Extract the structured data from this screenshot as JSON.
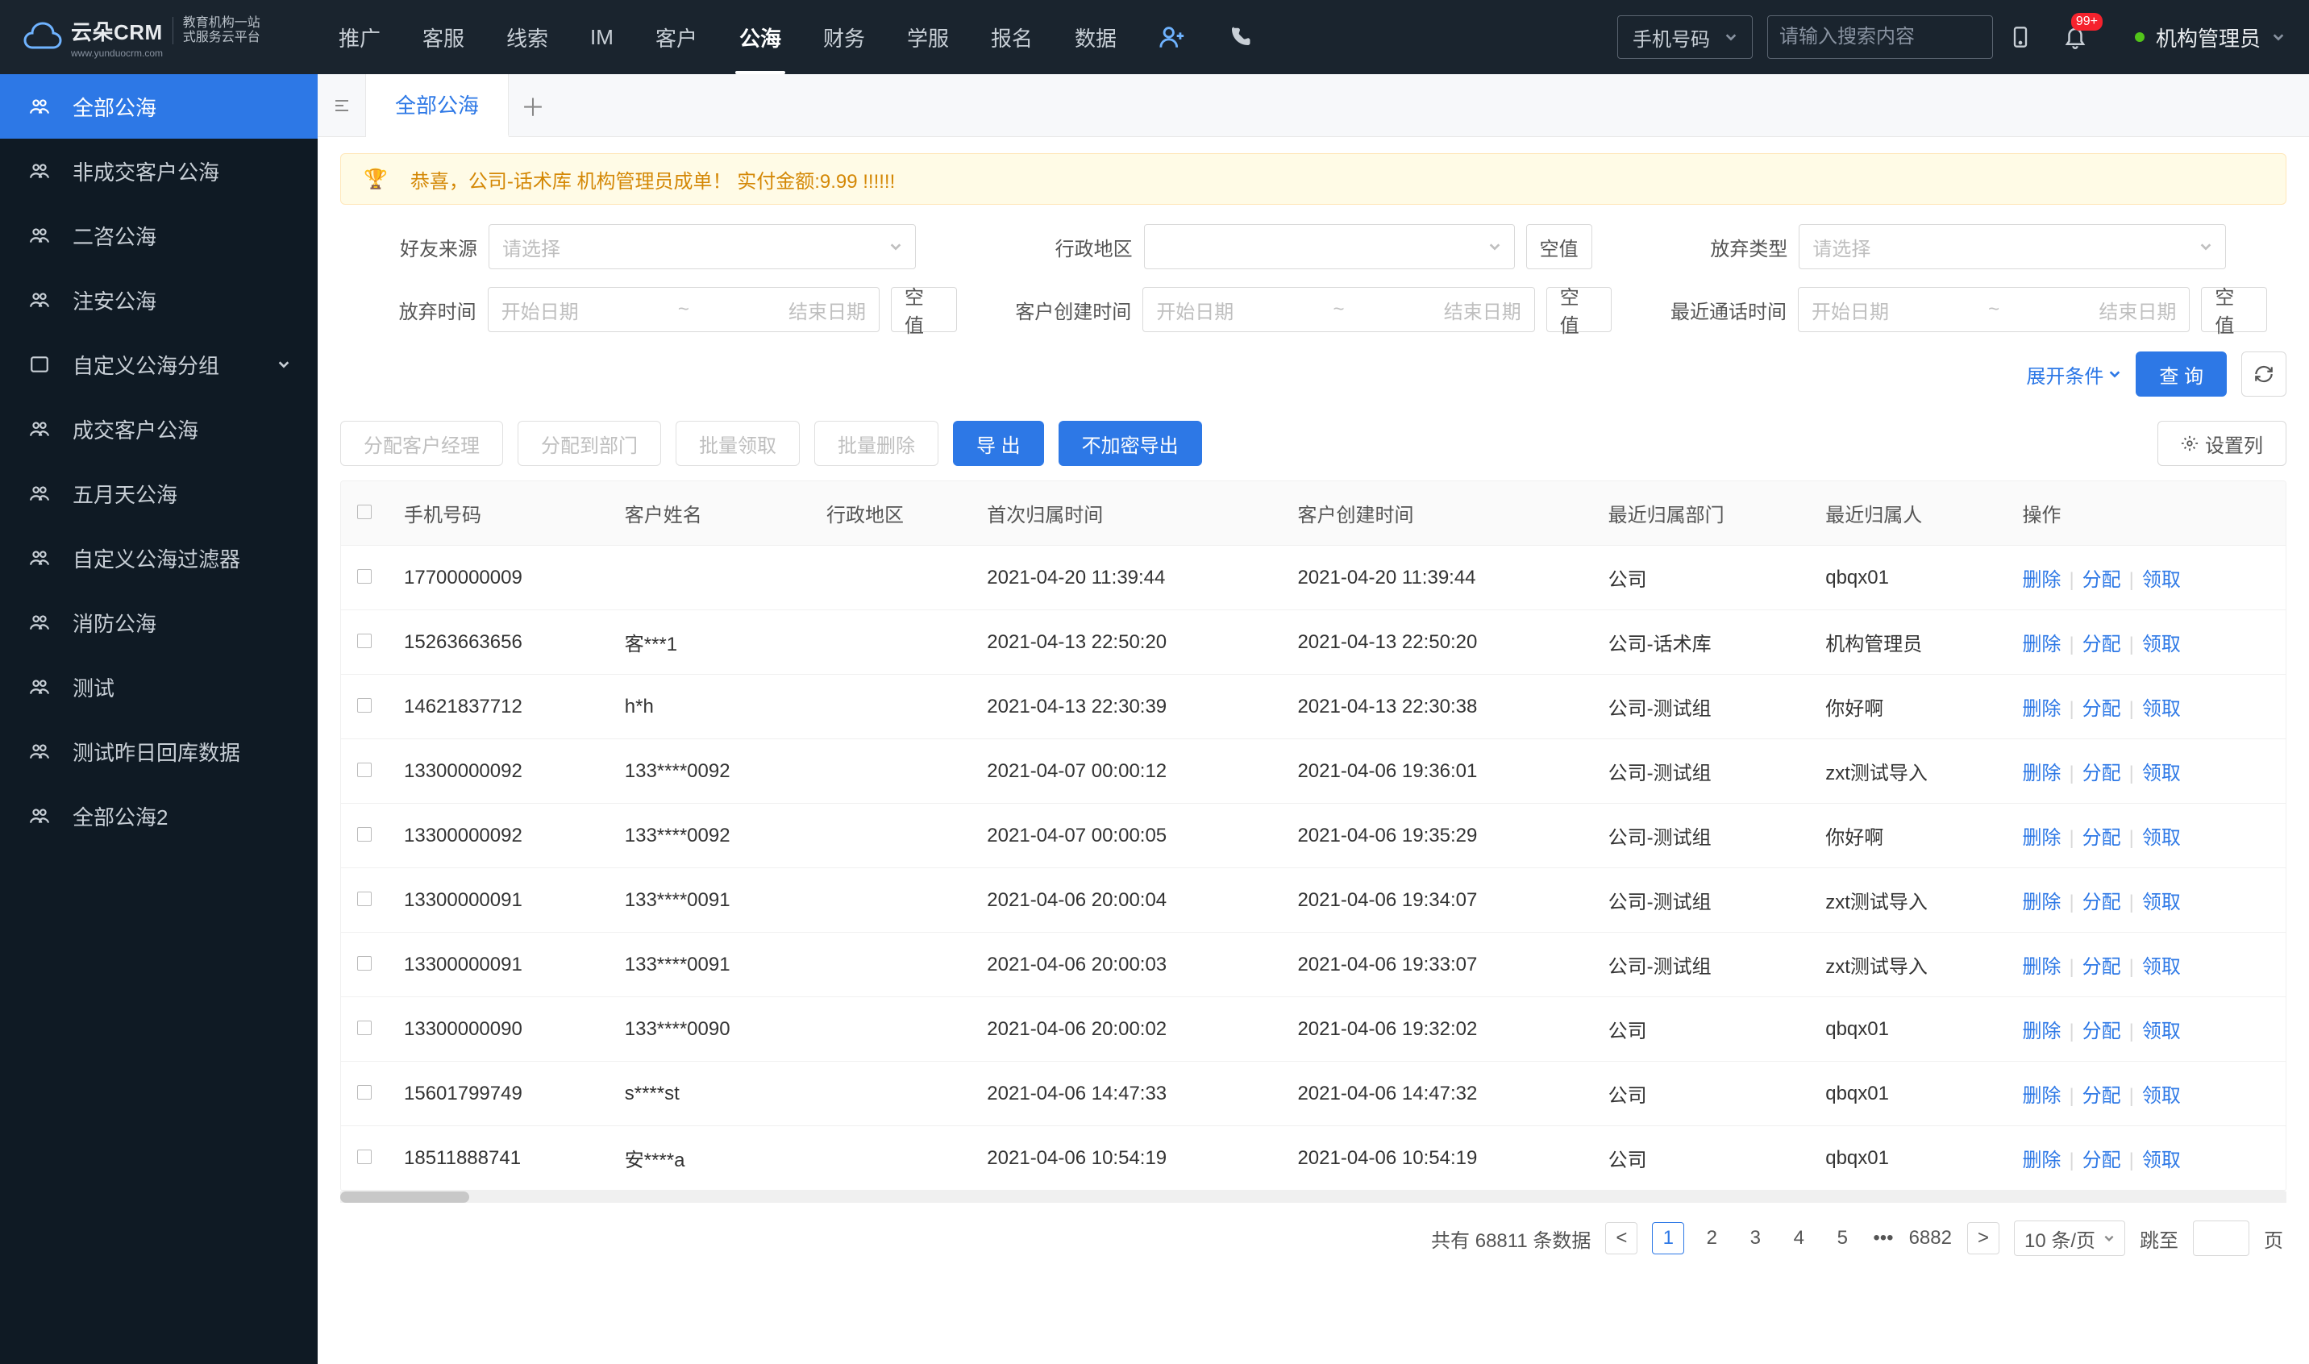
{
  "header": {
    "logo_main": "云朵CRM",
    "logo_sub_line1": "教育机构一站",
    "logo_sub_line2": "式服务云平台",
    "logo_url": "www.yunduocrm.com",
    "nav": [
      "推广",
      "客服",
      "线索",
      "IM",
      "客户",
      "公海",
      "财务",
      "学服",
      "报名",
      "数据"
    ],
    "nav_active_index": 5,
    "search_type": "手机号码",
    "search_placeholder": "请输入搜索内容",
    "badge": "99+",
    "user": "机构管理员"
  },
  "sidebar": {
    "items": [
      {
        "label": "全部公海",
        "icon": "users"
      },
      {
        "label": "非成交客户公海",
        "icon": "users"
      },
      {
        "label": "二咨公海",
        "icon": "users"
      },
      {
        "label": "注安公海",
        "icon": "users"
      },
      {
        "label": "自定义公海分组",
        "icon": "folder",
        "expandable": true
      },
      {
        "label": "成交客户公海",
        "icon": "users"
      },
      {
        "label": "五月天公海",
        "icon": "users"
      },
      {
        "label": "自定义公海过滤器",
        "icon": "users"
      },
      {
        "label": "消防公海",
        "icon": "users"
      },
      {
        "label": "测试",
        "icon": "users"
      },
      {
        "label": "测试昨日回库数据",
        "icon": "users"
      },
      {
        "label": "全部公海2",
        "icon": "users"
      }
    ],
    "active_index": 0
  },
  "tabs": {
    "items": [
      "全部公海"
    ]
  },
  "banner": "恭喜，公司-话术库  机构管理员成单！  实付金额:9.99 !!!!!!",
  "filters": {
    "friend_source": {
      "label": "好友来源",
      "placeholder": "请选择"
    },
    "admin_area": {
      "label": "行政地区",
      "placeholder": "",
      "null_btn": "空值"
    },
    "abandon_type": {
      "label": "放弃类型",
      "placeholder": "请选择"
    },
    "abandon_time": {
      "label": "放弃时间",
      "start": "开始日期",
      "end": "结束日期",
      "null_btn": "空值"
    },
    "create_time": {
      "label": "客户创建时间",
      "start": "开始日期",
      "end": "结束日期",
      "null_btn": "空值"
    },
    "recent_call": {
      "label": "最近通话时间",
      "start": "开始日期",
      "end": "结束日期",
      "null_btn": "空值"
    },
    "expand": "展开条件",
    "query": "查 询"
  },
  "toolbar": {
    "assign_manager": "分配客户经理",
    "assign_dept": "分配到部门",
    "batch_claim": "批量领取",
    "batch_delete": "批量删除",
    "export": "导 出",
    "export_noenc": "不加密导出",
    "set_columns": "设置列"
  },
  "table": {
    "columns": [
      "",
      "手机号码",
      "客户姓名",
      "行政地区",
      "首次归属时间",
      "客户创建时间",
      "最近归属部门",
      "最近归属人",
      "操作"
    ],
    "ops": {
      "delete": "删除",
      "assign": "分配",
      "claim": "领取"
    },
    "rows": [
      {
        "phone": "17700000009",
        "name": "",
        "area": "",
        "first": "2021-04-20 11:39:44",
        "create": "2021-04-20 11:39:44",
        "dept": "公司",
        "owner": "qbqx01"
      },
      {
        "phone": "15263663656",
        "name": "客***1",
        "area": "",
        "first": "2021-04-13 22:50:20",
        "create": "2021-04-13 22:50:20",
        "dept": "公司-话术库",
        "owner": "机构管理员"
      },
      {
        "phone": "14621837712",
        "name": "h*h",
        "area": "",
        "first": "2021-04-13 22:30:39",
        "create": "2021-04-13 22:30:38",
        "dept": "公司-测试组",
        "owner": "你好啊"
      },
      {
        "phone": "13300000092",
        "name": "133****0092",
        "area": "",
        "first": "2021-04-07 00:00:12",
        "create": "2021-04-06 19:36:01",
        "dept": "公司-测试组",
        "owner": "zxt测试导入"
      },
      {
        "phone": "13300000092",
        "name": "133****0092",
        "area": "",
        "first": "2021-04-07 00:00:05",
        "create": "2021-04-06 19:35:29",
        "dept": "公司-测试组",
        "owner": "你好啊"
      },
      {
        "phone": "13300000091",
        "name": "133****0091",
        "area": "",
        "first": "2021-04-06 20:00:04",
        "create": "2021-04-06 19:34:07",
        "dept": "公司-测试组",
        "owner": "zxt测试导入"
      },
      {
        "phone": "13300000091",
        "name": "133****0091",
        "area": "",
        "first": "2021-04-06 20:00:03",
        "create": "2021-04-06 19:33:07",
        "dept": "公司-测试组",
        "owner": "zxt测试导入"
      },
      {
        "phone": "13300000090",
        "name": "133****0090",
        "area": "",
        "first": "2021-04-06 20:00:02",
        "create": "2021-04-06 19:32:02",
        "dept": "公司",
        "owner": "qbqx01"
      },
      {
        "phone": "15601799749",
        "name": "s****st",
        "area": "",
        "first": "2021-04-06 14:47:33",
        "create": "2021-04-06 14:47:32",
        "dept": "公司",
        "owner": "qbqx01"
      },
      {
        "phone": "18511888741",
        "name": "安****a",
        "area": "",
        "first": "2021-04-06 10:54:19",
        "create": "2021-04-06 10:54:19",
        "dept": "公司",
        "owner": "qbqx01"
      }
    ]
  },
  "pager": {
    "total_prefix": "共有",
    "total": "68811",
    "total_suffix": "条数据",
    "pages": [
      "1",
      "2",
      "3",
      "4",
      "5"
    ],
    "last": "6882",
    "size": "10 条/页",
    "jump": "跳至",
    "page_suffix": "页"
  }
}
